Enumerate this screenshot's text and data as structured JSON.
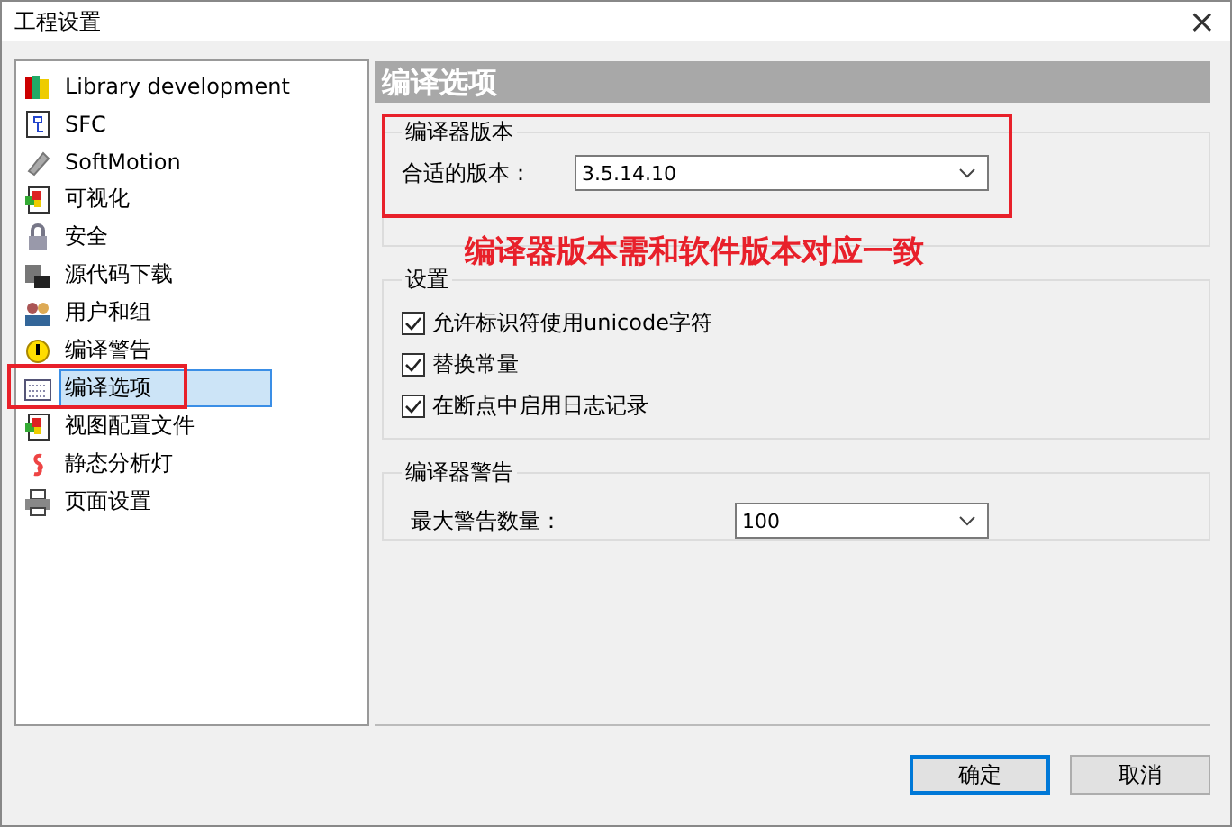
{
  "window": {
    "title": "工程设置",
    "close": "×"
  },
  "sidebar": {
    "items": [
      {
        "label": "Library development",
        "selected": false
      },
      {
        "label": "SFC",
        "selected": false
      },
      {
        "label": "SoftMotion",
        "selected": false
      },
      {
        "label": "可视化",
        "selected": false
      },
      {
        "label": "安全",
        "selected": false
      },
      {
        "label": "源代码下载",
        "selected": false
      },
      {
        "label": "用户和组",
        "selected": false
      },
      {
        "label": "编译警告",
        "selected": false
      },
      {
        "label": "编译选项",
        "selected": true
      },
      {
        "label": "视图配置文件",
        "selected": false
      },
      {
        "label": "静态分析灯",
        "selected": false
      },
      {
        "label": "页面设置",
        "selected": false
      }
    ]
  },
  "panel": {
    "title": "编译选项",
    "compiler_version": {
      "legend": "编译器版本",
      "label": "合适的版本：",
      "value": "3.5.14.10"
    },
    "settings": {
      "legend": "设置",
      "options": [
        {
          "label": "允许标识符使用unicode字符",
          "checked": true
        },
        {
          "label": "替换常量",
          "checked": true
        },
        {
          "label": "在断点中启用日志记录",
          "checked": true
        }
      ]
    },
    "warnings": {
      "legend": "编译器警告",
      "label": "最大警告数量：",
      "value": "100"
    }
  },
  "annotation": {
    "text": "编译器版本需和软件版本对应一致"
  },
  "buttons": [
    {
      "label": "确定",
      "default": true
    },
    {
      "label": "取消",
      "default": false
    }
  ]
}
